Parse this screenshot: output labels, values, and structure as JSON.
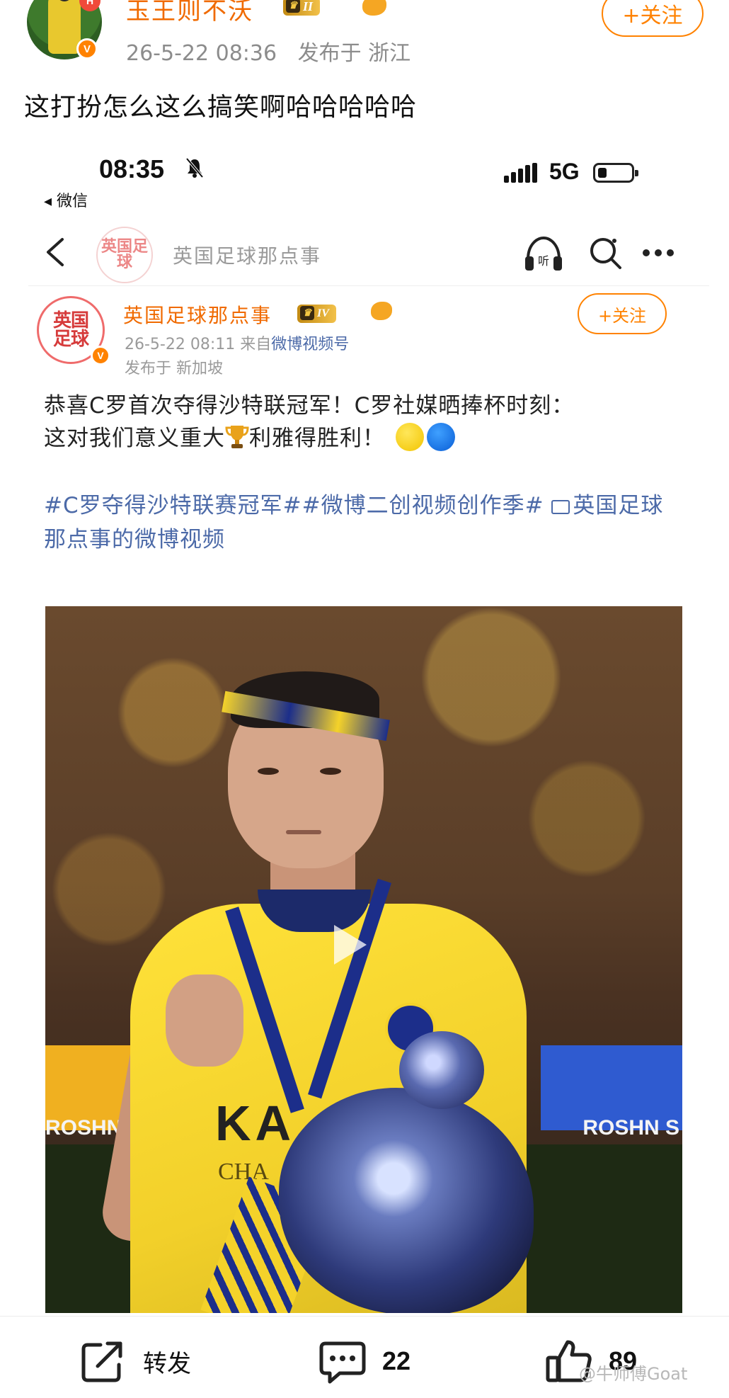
{
  "outer_post": {
    "username": "玉王则不沃",
    "level_badge": "II",
    "notification_badge": "H",
    "verified_badge": "V",
    "timestamp": "26-5-22 08:36",
    "location": "发布于 浙江",
    "follow_label": "+关注",
    "text": "这打扮怎么这么搞笑啊哈哈哈哈哈"
  },
  "embedded_screenshot": {
    "status_bar": {
      "time": "08:35",
      "back_app": "◂ 微信",
      "network": "5G"
    },
    "nav": {
      "avatar_text": "英国足球",
      "title": "英国足球那点事"
    },
    "post": {
      "avatar_text_top": "英国",
      "avatar_text_bottom": "足球",
      "username": "英国足球那点事",
      "level_badge": "IV",
      "verified_badge": "V",
      "timestamp": "26-5-22 08:11",
      "source_prefix": "来自",
      "source": "微博视频号",
      "location": "发布于 新加坡",
      "follow_label": "+关注",
      "body_line1": "恭喜C罗首次夺得沙特联冠军！C罗社媒晒捧杯时刻：",
      "body_line2a": "这对我们意义重大",
      "body_line2b": "利雅得胜利！",
      "tags_line": "#C罗夺得沙特联赛冠军##微博二创视频创作季#",
      "video_link": "英国足球那点事的微博视频",
      "photo_text": {
        "board_left": "ROSHN S",
        "board_right": "ROSHN S",
        "sponsor_1": "KA",
        "sponsor_2": "CHA"
      }
    }
  },
  "action_bar": {
    "repost_label": "转发",
    "comment_count": "22",
    "like_count": "89"
  },
  "watermark": "@牛师傅Goat",
  "colors": {
    "accent_orange": "#ff8200",
    "username_orange": "#f06a00",
    "link_blue": "#4c6aa8"
  }
}
